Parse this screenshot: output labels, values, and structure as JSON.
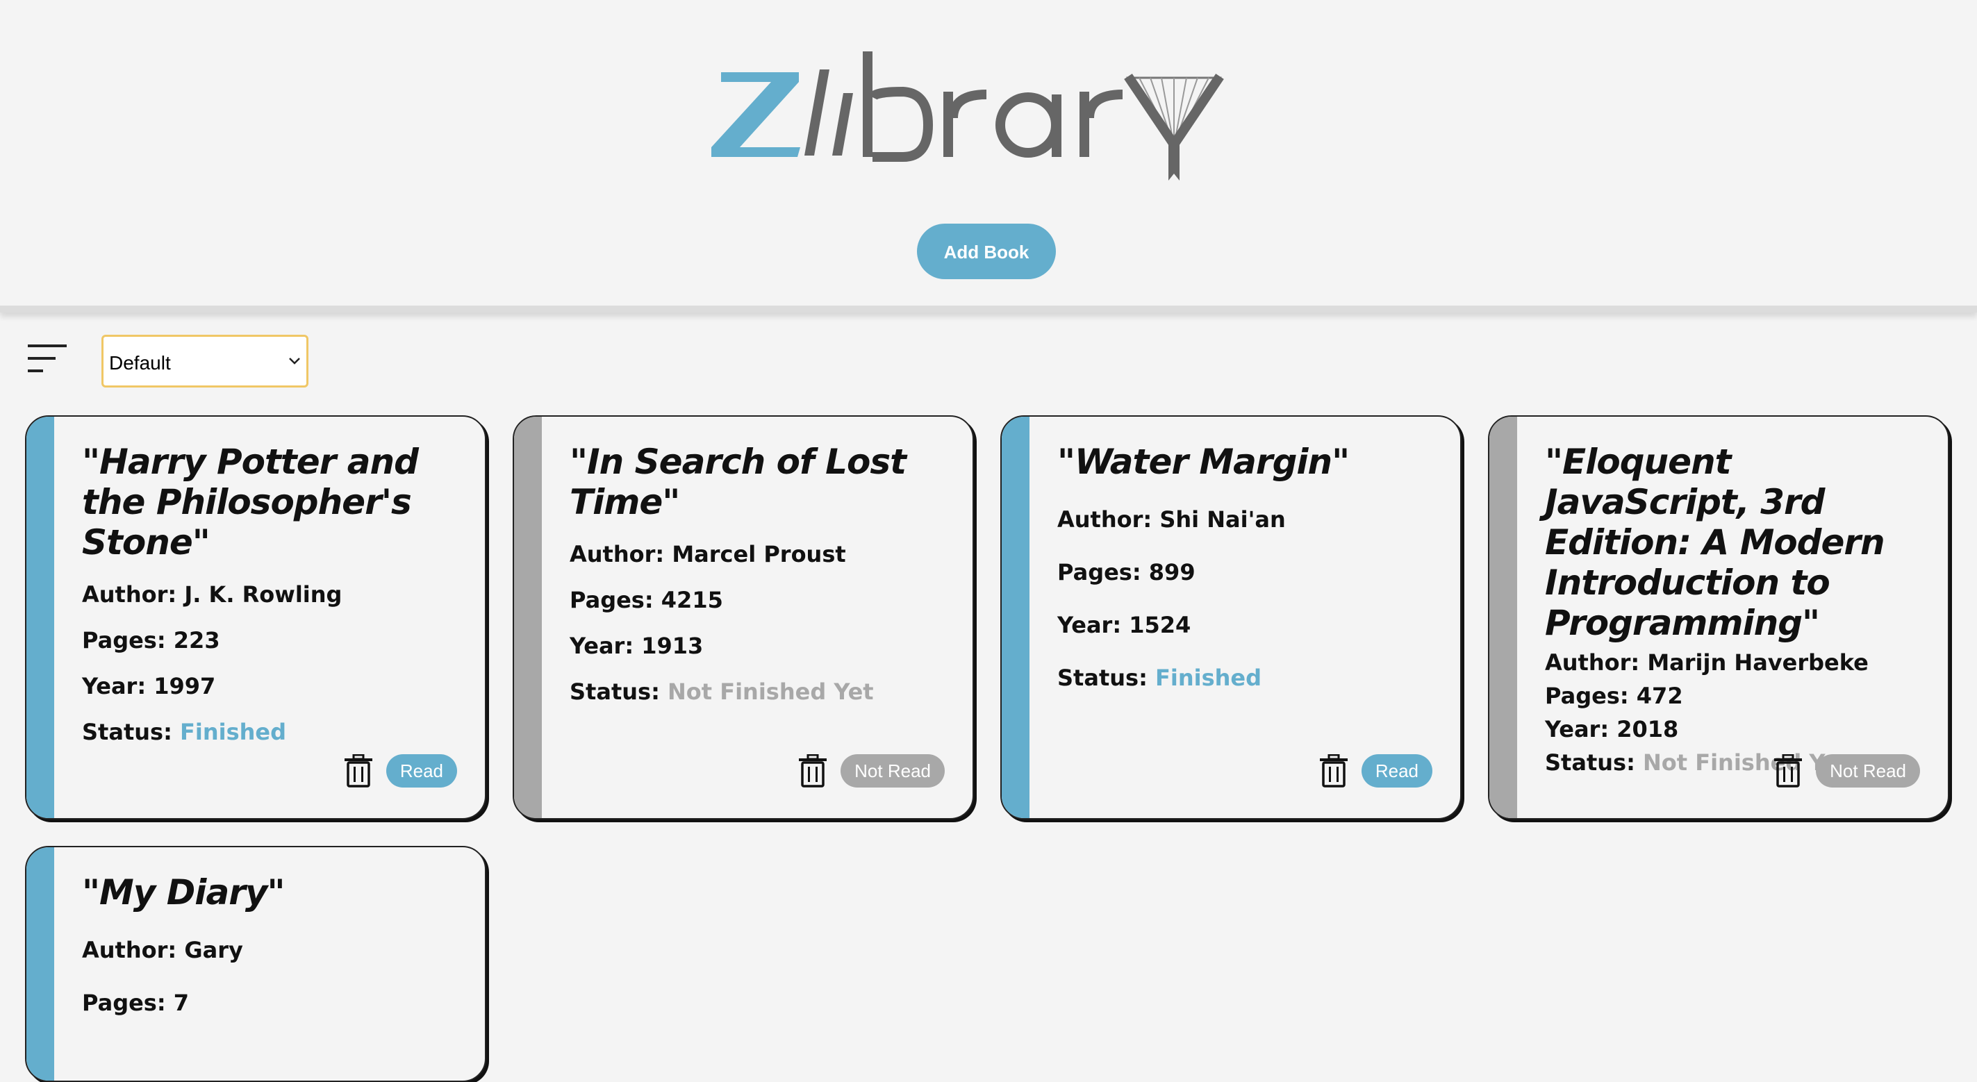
{
  "header": {
    "logo_text": "zlibrary",
    "add_book_label": "Add Book"
  },
  "toolbar": {
    "sort_select_value": "Default"
  },
  "colors": {
    "accent": "#64aecd",
    "muted": "#a8a8a8",
    "logo_gray": "#666666"
  },
  "labels": {
    "author": "Author:",
    "pages": "Pages:",
    "year": "Year:",
    "status": "Status:"
  },
  "books": [
    {
      "title": "\"Harry Potter and the Philosopher's Stone\"",
      "author": "J. K. Rowling",
      "pages": "223",
      "year": "1997",
      "status": "Finished",
      "toggle_label": "Read",
      "read": true
    },
    {
      "title": "\"In Search of Lost Time\"",
      "author": "Marcel Proust",
      "pages": "4215",
      "year": "1913",
      "status": "Not Finished Yet",
      "toggle_label": "Not Read",
      "read": false
    },
    {
      "title": "\"Water Margin\"",
      "author": "Shi Nai'an",
      "pages": "899",
      "year": "1524",
      "status": "Finished",
      "toggle_label": "Read",
      "read": true
    },
    {
      "title": "\"Eloquent JavaScript, 3rd Edition: A Modern Introduction to Programming\"",
      "author": "Marijn Haverbeke",
      "pages": "472",
      "year": "2018",
      "status": "Not Finished Yet",
      "toggle_label": "Not Read",
      "read": false
    },
    {
      "title": "\"My Diary\"",
      "author": "Gary",
      "pages": "7"
    }
  ]
}
